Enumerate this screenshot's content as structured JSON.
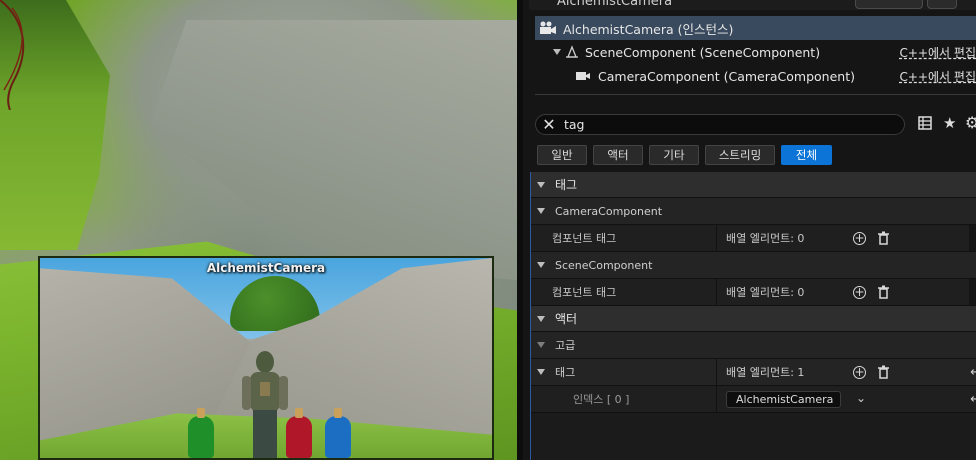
{
  "viewport": {
    "preview_title": "AlchemistCamera"
  },
  "window": {
    "title": "AlchemistCamera"
  },
  "components": {
    "items": [
      {
        "label": "AlchemistCamera (인스턴스)",
        "edit": ""
      },
      {
        "label": "SceneComponent (SceneComponent)",
        "edit": "C++에서 편집"
      },
      {
        "label": "CameraComponent (CameraComponent)",
        "edit": "C++에서 편집"
      }
    ]
  },
  "search": {
    "value": "tag"
  },
  "filters": [
    "일반",
    "액터",
    "기타",
    "스트리밍",
    "전체"
  ],
  "details": {
    "cat_tags": "태그",
    "camera_component": "CameraComponent",
    "component_tag_label": "컴포넌트 태그",
    "array_elements_0": "배열 엘리먼트: 0",
    "scene_component": "SceneComponent",
    "cat_actor": "액터",
    "advanced": "고급",
    "tags_label": "태그",
    "array_elements_1": "배열 엘리먼트: 1",
    "index_label": "인덱스 [ 0 ]",
    "index_value": "AlchemistCamera"
  },
  "icons": [
    "camera-actor-icon",
    "scene-component-icon",
    "camera-component-icon",
    "clear-search-icon",
    "table-view-icon",
    "favorite-star-icon",
    "settings-gear-icon",
    "add-element-icon",
    "delete-trash-icon",
    "reset-arrow-icon",
    "dropdown-chevron-icon"
  ],
  "colors": {
    "accent": "#0c74d6",
    "selection": "#3a4a5e"
  }
}
